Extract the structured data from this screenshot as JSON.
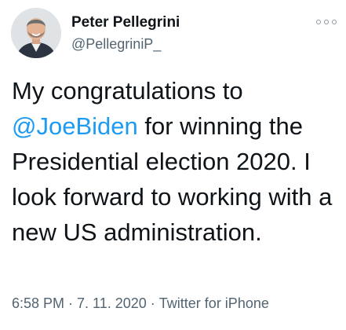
{
  "author": {
    "display_name": "Peter Pellegrini",
    "handle": "@PellegriniP_"
  },
  "tweet": {
    "text_before": "My congratulations to ",
    "mention": "@JoeBiden",
    "text_after": " for winning the Presidential election 2020. I look forward to working with a new US administration."
  },
  "meta": {
    "time": "6:58 PM",
    "separator": "·",
    "date": "7. 11. 2020",
    "source": "Twitter for iPhone"
  },
  "icons": {
    "more": "more-options-icon",
    "avatar": "profile-photo"
  },
  "colors": {
    "text": "#0f1419",
    "secondary": "#536471",
    "link": "#1d9bf0"
  }
}
